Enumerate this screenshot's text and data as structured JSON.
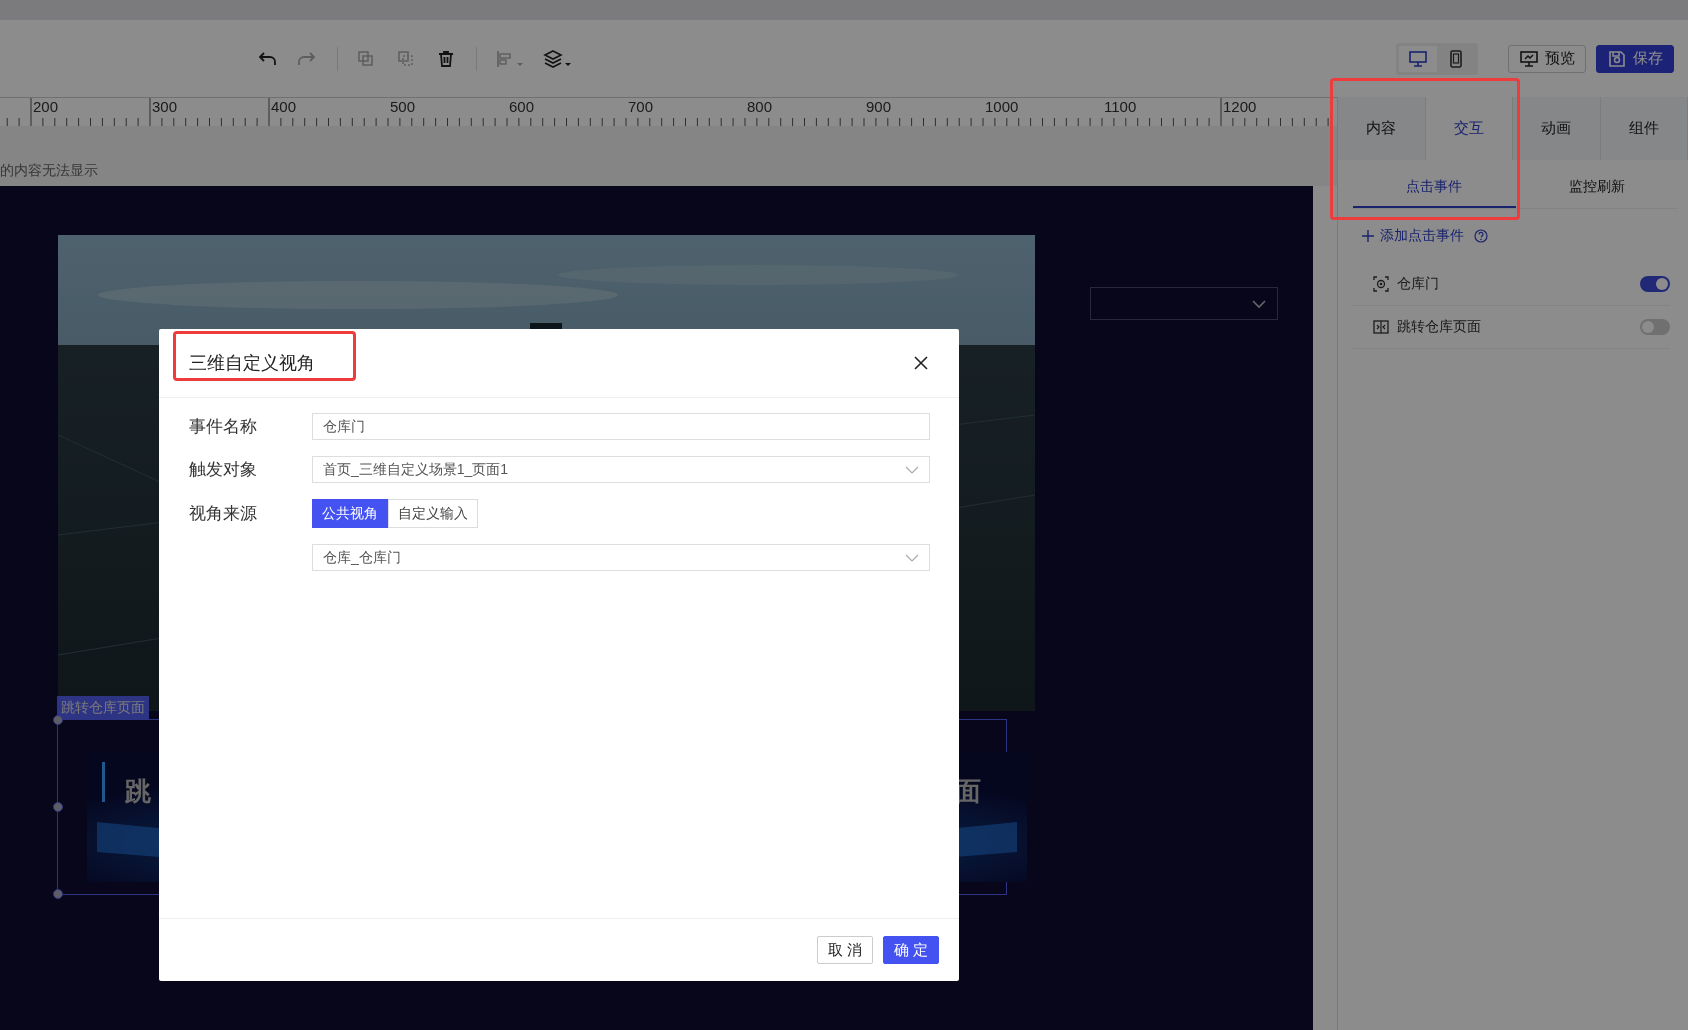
{
  "toolbar": {
    "tools": [
      {
        "kind": "undo",
        "disabled": false
      },
      {
        "kind": "redo",
        "disabled": true
      },
      {
        "kind": "separator"
      },
      {
        "kind": "copy",
        "disabled": true
      },
      {
        "kind": "paste",
        "disabled": true
      },
      {
        "kind": "delete",
        "disabled": false
      },
      {
        "kind": "separator"
      },
      {
        "kind": "align",
        "disabled": true
      },
      {
        "kind": "layers",
        "disabled": false
      }
    ],
    "devices": [
      {
        "kind": "desktop",
        "selected": true
      },
      {
        "kind": "mobile",
        "selected": false
      }
    ],
    "actions": [
      {
        "kind": "preview",
        "label": "预览"
      },
      {
        "kind": "save",
        "label": "保存"
      }
    ]
  },
  "ruler": {
    "labels": [
      "200",
      "300",
      "400",
      "500",
      "600",
      "700",
      "800",
      "900",
      "1000",
      "1100",
      "1200"
    ]
  },
  "canvas_notice": "的内容无法显示",
  "canvas": {
    "component_tag": "跳转仓库页面",
    "button_text_left": "跳",
    "button_text_right": "面"
  },
  "panel": {
    "highlighted": true,
    "tabs": [
      {
        "label": "内容",
        "selected": false
      },
      {
        "label": "交互",
        "selected": true
      },
      {
        "label": "动画",
        "selected": false
      },
      {
        "label": "组件",
        "selected": false
      }
    ],
    "subtabs": [
      {
        "label": "点击事件",
        "selected": true
      },
      {
        "label": "监控刷新",
        "selected": false
      }
    ],
    "add_event": "添加点击事件",
    "events": [
      {
        "kind": "camera",
        "label": "仓库门",
        "on": true
      },
      {
        "kind": "jump",
        "label": "跳转仓库页面",
        "on": false
      }
    ]
  },
  "dialog": {
    "title": "三维自定义视角",
    "title_highlighted": true,
    "fields": [
      {
        "kind": "text",
        "label": "事件名称",
        "value": "仓库门"
      },
      {
        "kind": "select",
        "label": "触发对象",
        "value": "首页_三维自定义场景1_页面1"
      },
      {
        "kind": "segmented",
        "label": "视角来源",
        "options": [
          {
            "label": "公共视角",
            "selected": true
          },
          {
            "label": "自定义输入",
            "selected": false
          }
        ]
      },
      {
        "kind": "select",
        "value": "仓库_仓库门"
      }
    ],
    "buttons": [
      {
        "kind": "default",
        "label": "取 消"
      },
      {
        "kind": "primary",
        "label": "确 定"
      }
    ]
  }
}
